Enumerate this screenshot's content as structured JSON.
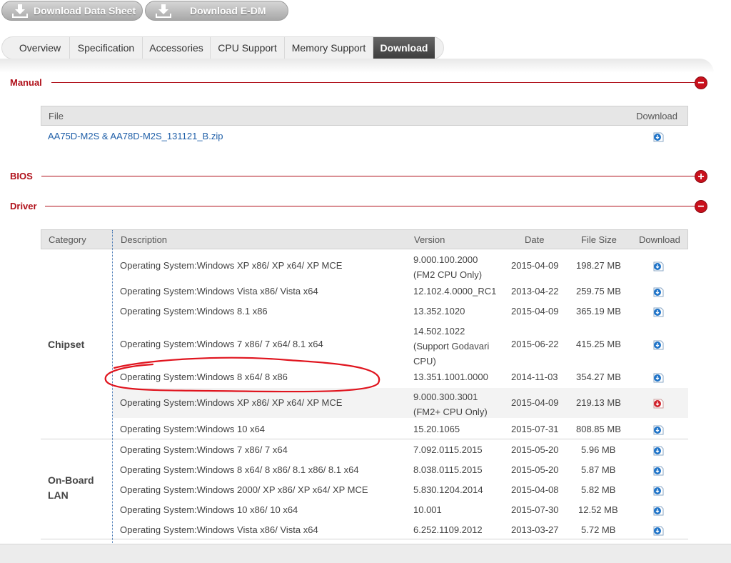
{
  "top_buttons": {
    "datasheet": "Download Data Sheet",
    "edm": "Download E-DM"
  },
  "tabs": [
    "Overview",
    "Specification",
    "Accessories",
    "CPU Support",
    "Memory Support",
    "Download"
  ],
  "active_tab": "Download",
  "sections": {
    "manual": "Manual",
    "bios": "BIOS",
    "driver": "Driver"
  },
  "manual_table": {
    "headers": {
      "file": "File",
      "download": "Download"
    },
    "rows": [
      {
        "file": "AA75D-M2S & AA78D-M2S_131121_B.zip"
      }
    ]
  },
  "driver_table": {
    "headers": {
      "category": "Category",
      "description": "Description",
      "version": "Version",
      "date": "Date",
      "size": "File Size",
      "download": "Download"
    },
    "groups": [
      {
        "category": "Chipset",
        "rows": [
          {
            "desc": "Operating System:Windows  XP x86/ XP x64/ XP MCE",
            "version": "9.000.100.2000 (FM2 CPU Only)",
            "date": "2015-04-09",
            "size": "198.27 MB"
          },
          {
            "desc": "Operating System:Windows  Vista x86/ Vista x64",
            "version": "12.102.4.0000_RC1",
            "date": "2013-04-22",
            "size": "259.75 MB"
          },
          {
            "desc": "Operating System:Windows  8.1 x86",
            "version": "13.352.1020",
            "date": "2015-04-09",
            "size": "365.19 MB"
          },
          {
            "desc": "Operating System:Windows  7 x86/ 7 x64/ 8.1 x64",
            "version": "14.502.1022 (Support Godavari CPU)",
            "date": "2015-06-22",
            "size": "415.25 MB"
          },
          {
            "desc": "Operating System:Windows  8 x64/ 8 x86",
            "version": "13.351.1001.0000",
            "date": "2014-11-03",
            "size": "354.27 MB"
          },
          {
            "desc": "Operating System:Windows  XP x86/ XP x64/ XP MCE",
            "version": "9.000.300.3001 (FM2+ CPU Only)",
            "date": "2015-04-09",
            "size": "219.13 MB"
          },
          {
            "desc": "Operating System:Windows  10 x64",
            "version": "15.20.1065",
            "date": "2015-07-31",
            "size": "808.85 MB"
          }
        ]
      },
      {
        "category": "On-Board LAN",
        "rows": [
          {
            "desc": "Operating System:Windows  7 x86/ 7 x64",
            "version": "7.092.0115.2015",
            "date": "2015-05-20",
            "size": "5.96 MB"
          },
          {
            "desc": "Operating System:Windows  8 x64/ 8 x86/ 8.1 x86/ 8.1 x64",
            "version": "8.038.0115.2015",
            "date": "2015-05-20",
            "size": "5.87 MB"
          },
          {
            "desc": "Operating System:Windows  2000/ XP x86/ XP x64/ XP MCE",
            "version": "5.830.1204.2014",
            "date": "2015-04-08",
            "size": "5.82 MB"
          },
          {
            "desc": "Operating System:Windows  10 x86/ 10 x64",
            "version": "10.001",
            "date": "2015-07-30",
            "size": "12.52 MB"
          },
          {
            "desc": "Operating System:Windows  Vista x86/ Vista x64",
            "version": "6.252.1109.2012",
            "date": "2013-03-27",
            "size": "5.72 MB"
          }
        ]
      }
    ]
  },
  "colors": {
    "accent_red": "#b0101a",
    "link_blue": "#1f5fa8",
    "icon_blue": "#1e73c8",
    "icon_red": "#d0202a",
    "annotation_red": "#e0141e"
  }
}
